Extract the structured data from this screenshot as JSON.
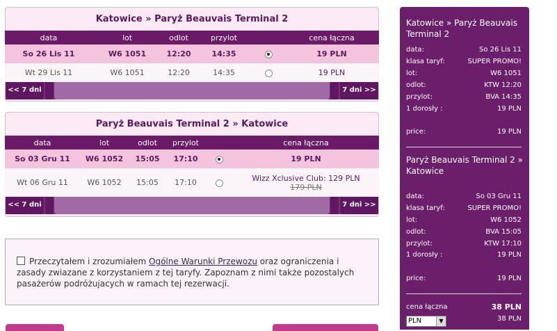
{
  "outbound": {
    "title": "Katowice » Paryż Beauvais Terminal 2",
    "headers": [
      "data",
      "lot",
      "odlot",
      "przylot",
      "",
      "cena łączna"
    ],
    "rows": [
      {
        "date": "So 26 Lis 11",
        "flight": "W6 1051",
        "dep": "12:20",
        "arr": "14:35",
        "selected": true,
        "price": "19 PLN"
      },
      {
        "date": "Wt 29 Lis 11",
        "flight": "W6 1051",
        "dep": "12:20",
        "arr": "14:35",
        "selected": false,
        "price": "19 PLN"
      }
    ],
    "prev": "<< 7 dni",
    "next": "7 dni >>"
  },
  "return": {
    "title": "Paryż Beauvais Terminal 2 » Katowice",
    "headers": [
      "data",
      "lot",
      "odlot",
      "przylot",
      "",
      "cena łączna"
    ],
    "rows": [
      {
        "date": "So 03 Gru 11",
        "flight": "W6 1052",
        "dep": "15:05",
        "arr": "17:10",
        "selected": true,
        "price": "19 PLN"
      },
      {
        "date": "Wt 06 Gru 11",
        "flight": "W6 1052",
        "dep": "15:05",
        "arr": "17:10",
        "selected": false,
        "club": "Wizz Xclusive Club: 129 PLN",
        "old_price": "179 PLN"
      }
    ],
    "prev": "<< 7 dni",
    "next": "7 dni >>"
  },
  "terms": {
    "before": "Przeczytałem i zrozumiałem ",
    "link": "Ogólne Warunki Przewozu",
    "after": " oraz ograniczenia i zasady zwiazane z korzystaniem z tej taryfy. Zapoznam z nimi także pozostalych pasażerów podróżujacych w ramach tej rezerwacji."
  },
  "sidebar": {
    "out_title": "Katowice » Paryż Beauvais Terminal 2",
    "out_rows": [
      {
        "k": "data:",
        "v": "So 26 Lis 11"
      },
      {
        "k": "klasa taryf:",
        "v": "SUPER PROMO!"
      },
      {
        "k": "lot:",
        "v": "W6 1051"
      },
      {
        "k": "odlot:",
        "v": "KTW 12:20"
      },
      {
        "k": "przylot:",
        "v": "BVA 14:35"
      },
      {
        "k": "1 dorosły :",
        "v": "19 PLN"
      }
    ],
    "out_price": {
      "k": "price:",
      "v": "19 PLN"
    },
    "ret_title": "Paryż Beauvais Terminal 2 » Katowice",
    "ret_rows": [
      {
        "k": "data:",
        "v": "So 03 Gru 11"
      },
      {
        "k": "klasa taryf:",
        "v": "SUPER PROMO!"
      },
      {
        "k": "lot:",
        "v": "W6 1052"
      },
      {
        "k": "odlot:",
        "v": "BVA 15:05"
      },
      {
        "k": "przylot:",
        "v": "KTW 17:10"
      },
      {
        "k": "1 dorosły :",
        "v": "19 PLN"
      }
    ],
    "ret_price": {
      "k": "price:",
      "v": "19 PLN"
    },
    "total": {
      "k": "cena łączna",
      "v": "38 PLN"
    },
    "currency": "PLN",
    "currency_total": "38 PLN"
  },
  "colors": {
    "accent": "#6b1a67",
    "selected_row": "#f4c3dd",
    "button": "#c23b8c"
  }
}
